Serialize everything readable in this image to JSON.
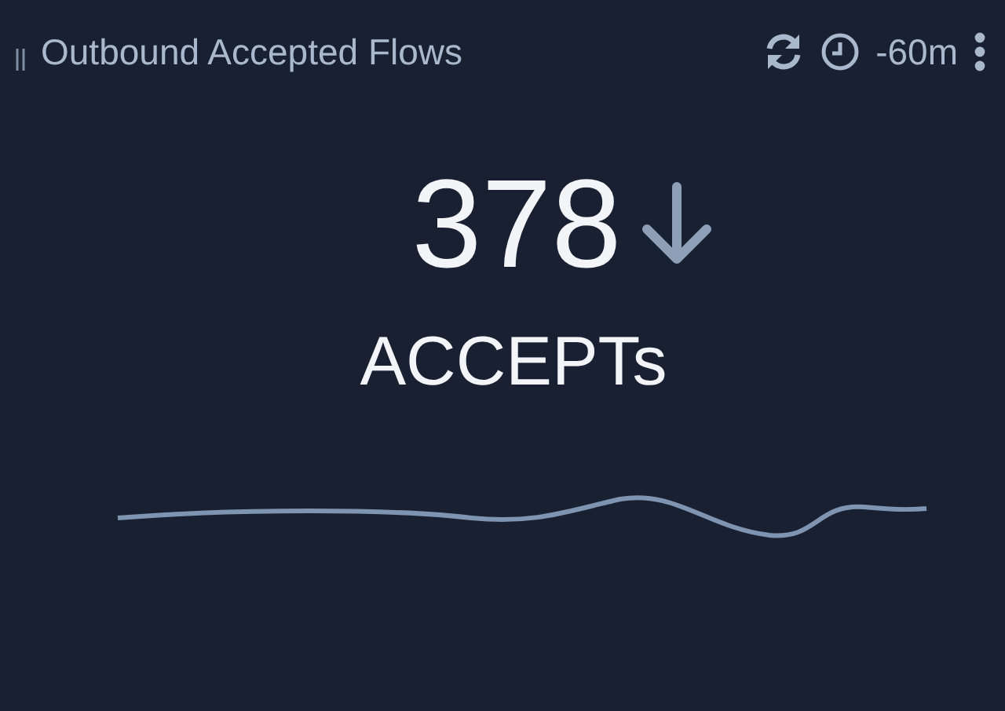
{
  "panel": {
    "title": "Outbound Accepted Flows",
    "time_range": "-60m"
  },
  "stat": {
    "value": "378",
    "decreasing": true,
    "unit": "ACCEPTs"
  }
}
